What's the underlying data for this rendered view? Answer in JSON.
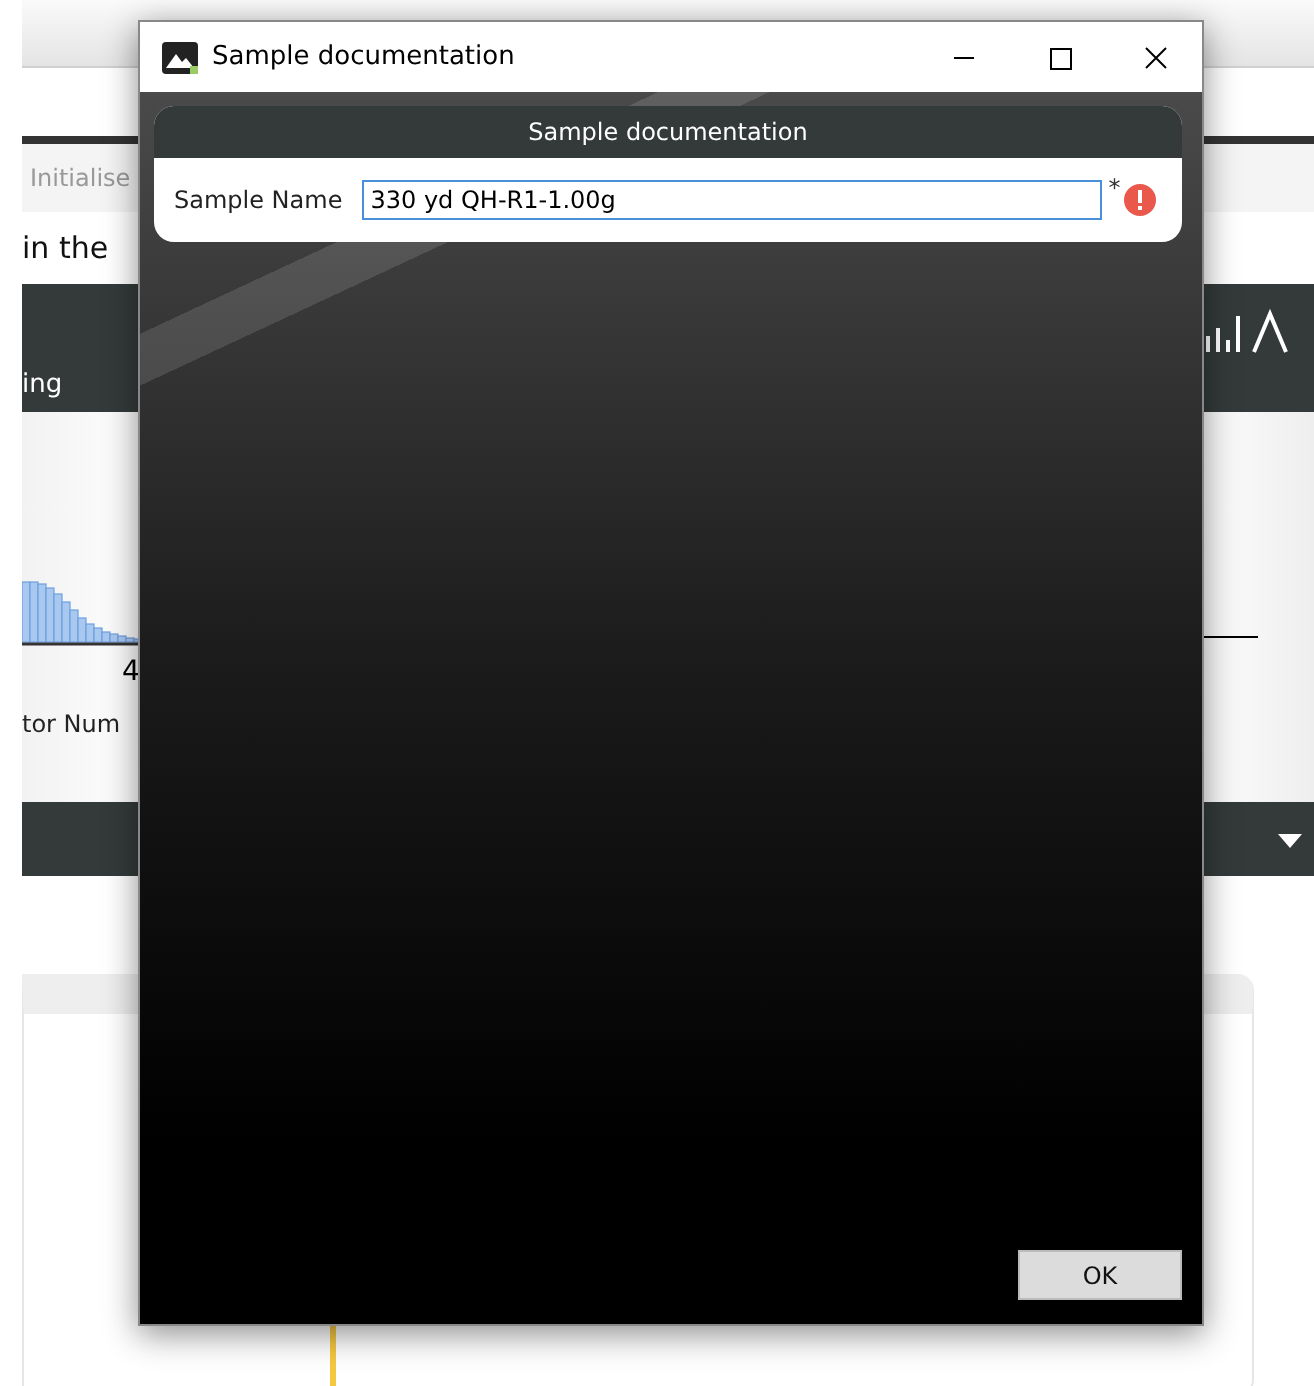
{
  "background": {
    "toolbar_button": "Initialise",
    "instruction": "in the",
    "section_title": "ing",
    "chart_axis_tick": "4",
    "chart_axis_label": "tor Num"
  },
  "dialog": {
    "title": "Sample documentation",
    "panel_title": "Sample documentation",
    "field": {
      "label": "Sample Name",
      "value": "330 yd QH-R1-1.00g",
      "required_mark": "*",
      "error": true
    },
    "buttons": [
      "OK"
    ]
  }
}
